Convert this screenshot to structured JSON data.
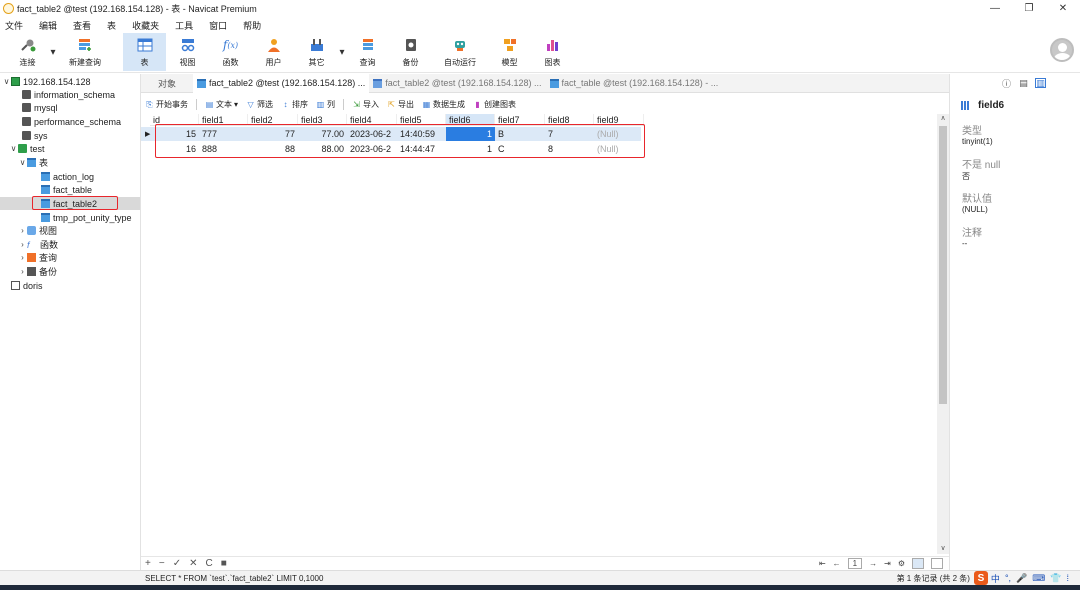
{
  "window": {
    "title": "fact_table2 @test (192.168.154.128) - 表 - Navicat Premium",
    "controls": [
      "—",
      "❐",
      "✕"
    ]
  },
  "menu": [
    "文件",
    "编辑",
    "查看",
    "表",
    "收藏夹",
    "工具",
    "窗口",
    "帮助"
  ],
  "toolbar": [
    {
      "label": "连接",
      "icon": "plug-icon",
      "color": "#3a9a3a"
    },
    {
      "label": "新建查询",
      "icon": "new-query-icon",
      "color": "#f07028"
    },
    {
      "label": "表",
      "icon": "table-icon",
      "color": "#3a7bd5",
      "active": true
    },
    {
      "label": "视图",
      "icon": "view-icon",
      "color": "#3a7bd5"
    },
    {
      "label": "函数",
      "icon": "function-icon",
      "color": "#3a7bd5"
    },
    {
      "label": "用户",
      "icon": "user-icon",
      "color": "#f0a020"
    },
    {
      "label": "其它",
      "icon": "other-icon",
      "color": "#3a7bd5"
    },
    {
      "label": "查询",
      "icon": "query-icon",
      "color": "#f07028"
    },
    {
      "label": "备份",
      "icon": "backup-icon",
      "color": "#555555"
    },
    {
      "label": "自动运行",
      "icon": "robot-icon",
      "color": "#2ea0a0"
    },
    {
      "label": "模型",
      "icon": "model-icon",
      "color": "#f0a020"
    },
    {
      "label": "图表",
      "icon": "chart-icon",
      "color": "#c040c0"
    }
  ],
  "tree": {
    "connection": "192.168.154.128",
    "databases": [
      "information_schema",
      "mysql",
      "performance_schema",
      "sys"
    ],
    "test_db": "test",
    "tables_group": "表",
    "tables": [
      "action_log",
      "fact_table",
      "fact_table2",
      "tmp_pot_unity_type"
    ],
    "views_group": "视图",
    "functions_group": "函数",
    "queries_group": "查询",
    "backups_group": "备份",
    "other_connection": "doris"
  },
  "tabs": [
    {
      "label": "对象"
    },
    {
      "label": "fact_table2 @test (192.168.154.128) ..."
    },
    {
      "label": "fact_table2 @test (192.168.154.128) ..."
    },
    {
      "label": "fact_table @test (192.168.154.128) - ..."
    }
  ],
  "grid_toolbar": {
    "begin_tx": "开始事务",
    "text": "文本",
    "filter": "筛选",
    "sort": "排序",
    "columns": "列",
    "import": "导入",
    "export": "导出",
    "generate": "数据生成",
    "create_chart": "创建图表"
  },
  "grid": {
    "columns": [
      "id",
      "field1",
      "field2",
      "field3",
      "field4",
      "field5",
      "field6",
      "field7",
      "field8",
      "field9"
    ],
    "rows": [
      [
        "15",
        "777",
        "77",
        "77.00",
        "2023-06-2",
        "14:40:59",
        "1",
        "B",
        "7",
        "(Null)"
      ],
      [
        "16",
        "888",
        "88",
        "88.00",
        "2023-06-2",
        "14:44:47",
        "1",
        "C",
        "8",
        "(Null)"
      ]
    ],
    "selected_column": "field6"
  },
  "nav": {
    "buttons": [
      "+",
      "−",
      "✓",
      "✕",
      "C",
      "■"
    ],
    "page": "1",
    "page_buttons": [
      "⇤",
      "←",
      "→",
      "⇥",
      "⚙"
    ]
  },
  "status": {
    "sql": "SELECT * FROM `test`.`fact_table2` LIMIT 0,1000",
    "records": "第 1 条记录 (共 2 条)",
    "ime_logo": "S",
    "ime_items": [
      "中",
      "°,",
      "🎤",
      "⌨",
      "👕",
      "⁞"
    ]
  },
  "right_panel": {
    "icons": [
      "ⓘ",
      "▤",
      "▥"
    ],
    "field_name": "field6",
    "type_label": "类型",
    "type_value": "tinyint(1)",
    "notnull_label": "不是 null",
    "notnull_value": "否",
    "default_label": "默认值",
    "default_value": "(NULL)",
    "comment_label": "注释",
    "comment_value": "--"
  }
}
